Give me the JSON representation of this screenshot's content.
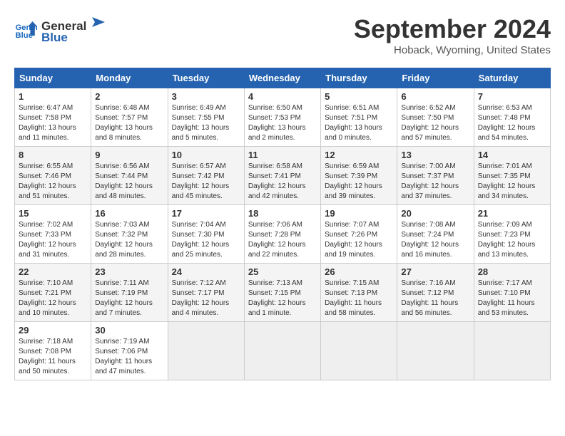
{
  "header": {
    "logo_line1": "General",
    "logo_line2": "Blue",
    "month_title": "September 2024",
    "location": "Hoback, Wyoming, United States"
  },
  "weekdays": [
    "Sunday",
    "Monday",
    "Tuesday",
    "Wednesday",
    "Thursday",
    "Friday",
    "Saturday"
  ],
  "weeks": [
    [
      {
        "day": 1,
        "sunrise": "6:47 AM",
        "sunset": "7:58 PM",
        "daylight": "13 hours and 11 minutes."
      },
      {
        "day": 2,
        "sunrise": "6:48 AM",
        "sunset": "7:57 PM",
        "daylight": "13 hours and 8 minutes."
      },
      {
        "day": 3,
        "sunrise": "6:49 AM",
        "sunset": "7:55 PM",
        "daylight": "13 hours and 5 minutes."
      },
      {
        "day": 4,
        "sunrise": "6:50 AM",
        "sunset": "7:53 PM",
        "daylight": "13 hours and 2 minutes."
      },
      {
        "day": 5,
        "sunrise": "6:51 AM",
        "sunset": "7:51 PM",
        "daylight": "13 hours and 0 minutes."
      },
      {
        "day": 6,
        "sunrise": "6:52 AM",
        "sunset": "7:50 PM",
        "daylight": "12 hours and 57 minutes."
      },
      {
        "day": 7,
        "sunrise": "6:53 AM",
        "sunset": "7:48 PM",
        "daylight": "12 hours and 54 minutes."
      }
    ],
    [
      {
        "day": 8,
        "sunrise": "6:55 AM",
        "sunset": "7:46 PM",
        "daylight": "12 hours and 51 minutes."
      },
      {
        "day": 9,
        "sunrise": "6:56 AM",
        "sunset": "7:44 PM",
        "daylight": "12 hours and 48 minutes."
      },
      {
        "day": 10,
        "sunrise": "6:57 AM",
        "sunset": "7:42 PM",
        "daylight": "12 hours and 45 minutes."
      },
      {
        "day": 11,
        "sunrise": "6:58 AM",
        "sunset": "7:41 PM",
        "daylight": "12 hours and 42 minutes."
      },
      {
        "day": 12,
        "sunrise": "6:59 AM",
        "sunset": "7:39 PM",
        "daylight": "12 hours and 39 minutes."
      },
      {
        "day": 13,
        "sunrise": "7:00 AM",
        "sunset": "7:37 PM",
        "daylight": "12 hours and 37 minutes."
      },
      {
        "day": 14,
        "sunrise": "7:01 AM",
        "sunset": "7:35 PM",
        "daylight": "12 hours and 34 minutes."
      }
    ],
    [
      {
        "day": 15,
        "sunrise": "7:02 AM",
        "sunset": "7:33 PM",
        "daylight": "12 hours and 31 minutes."
      },
      {
        "day": 16,
        "sunrise": "7:03 AM",
        "sunset": "7:32 PM",
        "daylight": "12 hours and 28 minutes."
      },
      {
        "day": 17,
        "sunrise": "7:04 AM",
        "sunset": "7:30 PM",
        "daylight": "12 hours and 25 minutes."
      },
      {
        "day": 18,
        "sunrise": "7:06 AM",
        "sunset": "7:28 PM",
        "daylight": "12 hours and 22 minutes."
      },
      {
        "day": 19,
        "sunrise": "7:07 AM",
        "sunset": "7:26 PM",
        "daylight": "12 hours and 19 minutes."
      },
      {
        "day": 20,
        "sunrise": "7:08 AM",
        "sunset": "7:24 PM",
        "daylight": "12 hours and 16 minutes."
      },
      {
        "day": 21,
        "sunrise": "7:09 AM",
        "sunset": "7:23 PM",
        "daylight": "12 hours and 13 minutes."
      }
    ],
    [
      {
        "day": 22,
        "sunrise": "7:10 AM",
        "sunset": "7:21 PM",
        "daylight": "12 hours and 10 minutes."
      },
      {
        "day": 23,
        "sunrise": "7:11 AM",
        "sunset": "7:19 PM",
        "daylight": "12 hours and 7 minutes."
      },
      {
        "day": 24,
        "sunrise": "7:12 AM",
        "sunset": "7:17 PM",
        "daylight": "12 hours and 4 minutes."
      },
      {
        "day": 25,
        "sunrise": "7:13 AM",
        "sunset": "7:15 PM",
        "daylight": "12 hours and 1 minute."
      },
      {
        "day": 26,
        "sunrise": "7:15 AM",
        "sunset": "7:13 PM",
        "daylight": "11 hours and 58 minutes."
      },
      {
        "day": 27,
        "sunrise": "7:16 AM",
        "sunset": "7:12 PM",
        "daylight": "11 hours and 56 minutes."
      },
      {
        "day": 28,
        "sunrise": "7:17 AM",
        "sunset": "7:10 PM",
        "daylight": "11 hours and 53 minutes."
      }
    ],
    [
      {
        "day": 29,
        "sunrise": "7:18 AM",
        "sunset": "7:08 PM",
        "daylight": "11 hours and 50 minutes."
      },
      {
        "day": 30,
        "sunrise": "7:19 AM",
        "sunset": "7:06 PM",
        "daylight": "11 hours and 47 minutes."
      },
      null,
      null,
      null,
      null,
      null
    ]
  ]
}
